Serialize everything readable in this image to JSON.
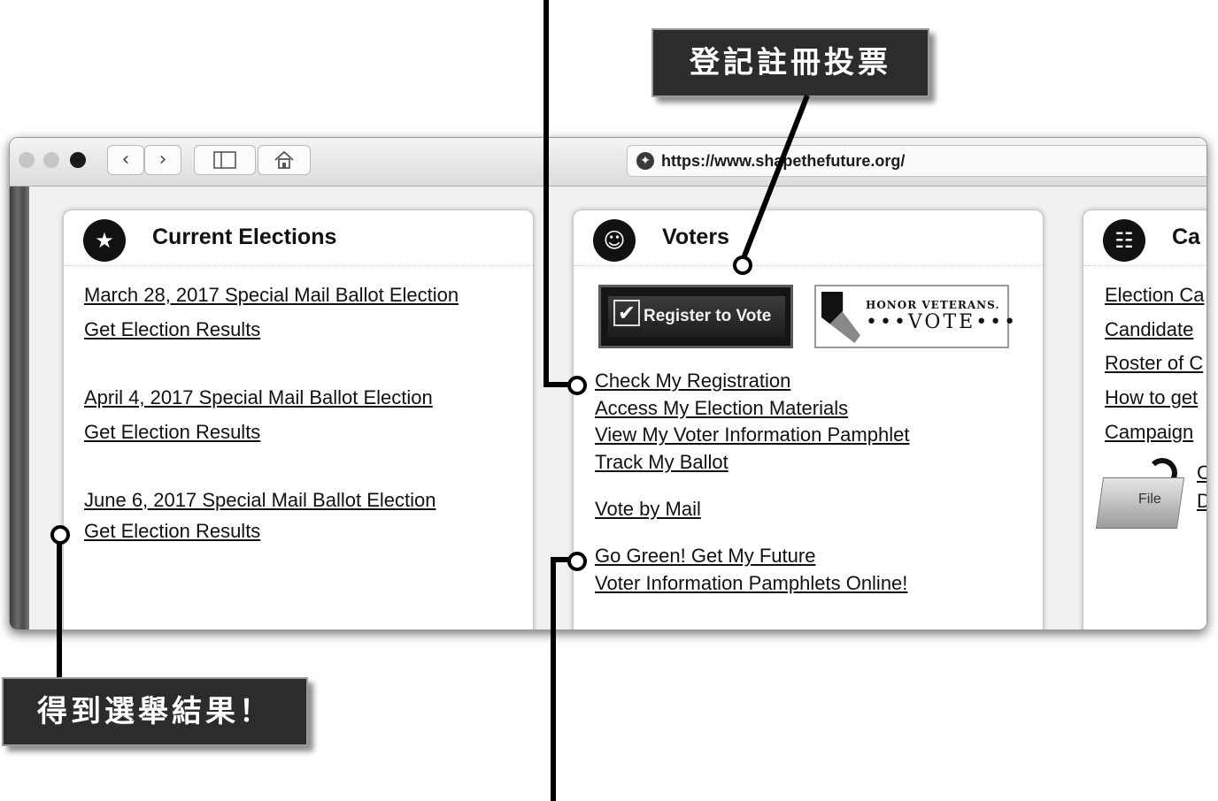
{
  "browser": {
    "url": "https://www.shapethefuture.org/",
    "back_icon": "chevron-left",
    "forward_icon": "chevron-right",
    "sidebar_icon": "sidebar",
    "home_icon": "home"
  },
  "cards": {
    "elections": {
      "title": "Current Elections",
      "icon": "calendar-star-icon",
      "links": [
        "March 28, 2017 Special Mail Ballot Election",
        "Get Election Results",
        "April 4, 2017 Special Mail Ballot Election",
        "Get Election Results",
        "June 6, 2017 Special Mail Ballot Election",
        "Get Election Results"
      ]
    },
    "voters": {
      "title": "Voters",
      "icon": "voters-icon",
      "register_badge": "Register to Vote",
      "veterans_badge": {
        "line1": "HONOR VETERANS.",
        "line2": "•••VOTE•••"
      },
      "links": [
        "Check My Registration",
        "Access My Election Materials",
        "View My Voter Information Pamphlet",
        "Track My Ballot",
        "Vote by Mail",
        "Go Green! Get My Future ",
        "Voter Information Pamphlets Online!"
      ]
    },
    "candidates": {
      "title": "Ca",
      "icon": "candidates-icon",
      "links": [
        "Election Ca",
        "Candidate",
        "Roster of C",
        "How to get",
        "Campaign"
      ],
      "folder_label": "File",
      "side_links": [
        "C",
        "D"
      ]
    }
  },
  "callouts": {
    "register": "登記註冊投票",
    "results": "得到選舉結果！"
  }
}
